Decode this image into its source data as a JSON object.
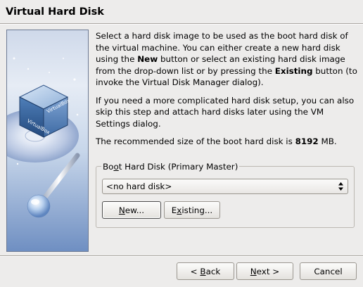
{
  "window": {
    "title": "Virtual Hard Disk"
  },
  "description": {
    "para1": {
      "t1": "Select a hard disk image to be used as the boot hard disk of the virtual machine. You can either create a new hard disk using the ",
      "b1": "New",
      "t2": " button or select an existing hard disk image from the drop-down list or by pressing the ",
      "b2": "Existing",
      "t3": " button (to invoke the Virtual Disk Manager dialog)."
    },
    "para2": "If you need a more complicated hard disk setup, you can also skip this step and attach hard disks later using the VM Settings dialog.",
    "para3": {
      "t1": "The recommended size of the boot hard disk is ",
      "b1": "8192",
      "t2": " MB."
    }
  },
  "boot_disk_group": {
    "title_pre": "Bo",
    "title_mnemonic": "o",
    "title_post": "t Hard Disk (Primary Master)",
    "combo_value": "<no hard disk>",
    "new_button": {
      "pre": "",
      "mnemonic": "N",
      "post": "ew..."
    },
    "existing_button": {
      "pre": "E",
      "mnemonic": "x",
      "post": "isting..."
    }
  },
  "footer": {
    "back_button": {
      "pre": "< ",
      "mnemonic": "B",
      "post": "ack"
    },
    "next_button": {
      "pre": "",
      "mnemonic": "N",
      "post": "ext >"
    },
    "cancel_label": "Cancel"
  },
  "icons": {
    "banner": "virtualbox-cube-disc-illustration",
    "combo_arrows": "up-down-arrows-icon"
  },
  "colors": {
    "background": "#edeceb",
    "banner_top": "#cfd9ea",
    "banner_bottom": "#6f8fc2",
    "focus_border": "#4b4b4b"
  }
}
